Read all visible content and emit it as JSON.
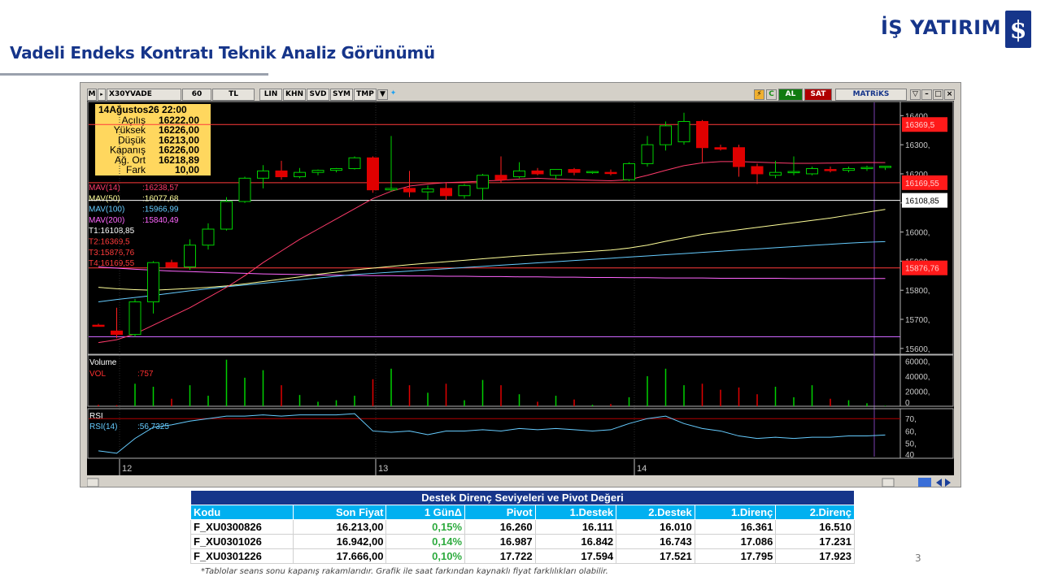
{
  "slide": {
    "title": "Vadeli Endeks Kontratı Teknik Analiz Görünümü",
    "logo_text": "İŞ YATIRIM",
    "page_number": "3",
    "footnote": "*Tablolar seans sonu kapanış rakamlarıdır. Grafik ile saat farkından kaynaklı fiyat farklılıkları olabilir."
  },
  "colors": {
    "brand": "#16358a",
    "table_header": "#00b0f0",
    "positive": "#2eab3f",
    "up_candle": "#00c000",
    "down_candle": "#e00000"
  },
  "toolbar": {
    "menu": "M",
    "symbol": "X30YVADE",
    "period": "60",
    "currency": "TL",
    "buttons": [
      "LIN",
      "KHN",
      "SVD",
      "SYM",
      "TMP"
    ],
    "al": "AL",
    "sat": "SAT",
    "brand": "MATRiKS"
  },
  "info_box": {
    "date": "14Ağustos26 22:00",
    "rows": [
      {
        "label": "Açılış",
        "value": "16222,00"
      },
      {
        "label": "Yüksek",
        "value": "16226,00"
      },
      {
        "label": "Düşük",
        "value": "16213,00"
      },
      {
        "label": "Kapanış",
        "value": "16226,00"
      },
      {
        "label": "Ağ. Ort",
        "value": "16218,89"
      },
      {
        "label": "Fark",
        "value": "10,00"
      }
    ]
  },
  "indicators": [
    {
      "label": "MAV(14)",
      "value": ":16238,57",
      "color": "#ff3b6b"
    },
    {
      "label": "MAV(50)",
      "value": ":16077,68",
      "color": "#ffff99"
    },
    {
      "label": "MAV(100)",
      "value": ":15966,99",
      "color": "#66ccff"
    },
    {
      "label": "MAV(200)",
      "value": ":15840,49",
      "color": "#ff66ff"
    },
    {
      "label": "T1:16108,85",
      "value": "",
      "color": "#ffffff"
    },
    {
      "label": "T2:16369,5",
      "value": "",
      "color": "#ff3b3b"
    },
    {
      "label": "T3:15876,76",
      "value": "",
      "color": "#ff3b3b"
    },
    {
      "label": "T4:16169,55",
      "value": "",
      "color": "#ff3b3b"
    }
  ],
  "price_axis": {
    "ticks": [
      "16400,",
      "16300,",
      "16200,",
      "16100,",
      "16000,",
      "15900,",
      "15800,",
      "15700,",
      "15600,"
    ],
    "markers": [
      {
        "label": "16369,5",
        "value": 16369.5,
        "style": "red"
      },
      {
        "label": "16169,55",
        "value": 16169.55,
        "style": "red"
      },
      {
        "label": "16108,85",
        "value": 16108.85,
        "style": "white"
      },
      {
        "label": "15876,76",
        "value": 15876.76,
        "style": "red"
      }
    ]
  },
  "volume_panel": {
    "title": "Volume",
    "label": "VOL",
    "value": ":757",
    "ticks": [
      "60000,",
      "40000,",
      "20000,",
      "0"
    ]
  },
  "rsi_panel": {
    "title": "RSI",
    "label": "RSI(14)",
    "value": ":56,7325",
    "ticks": [
      "70,",
      "60,",
      "50,",
      "40"
    ]
  },
  "x_axis": {
    "labels": [
      "12",
      "13",
      "14"
    ]
  },
  "chart_data": {
    "type": "candlestick",
    "price_range": [
      15580,
      16440
    ],
    "candles": [
      {
        "o": 15680,
        "h": 15685,
        "l": 15675,
        "c": 15678
      },
      {
        "o": 15660,
        "h": 15740,
        "l": 15635,
        "c": 15648
      },
      {
        "o": 15648,
        "h": 15770,
        "l": 15640,
        "c": 15760
      },
      {
        "o": 15760,
        "h": 15900,
        "l": 15720,
        "c": 15895
      },
      {
        "o": 15895,
        "h": 15905,
        "l": 15880,
        "c": 15880
      },
      {
        "o": 15880,
        "h": 15975,
        "l": 15870,
        "c": 15955
      },
      {
        "o": 15955,
        "h": 16030,
        "l": 15940,
        "c": 16010
      },
      {
        "o": 16010,
        "h": 16120,
        "l": 16005,
        "c": 16105
      },
      {
        "o": 16105,
        "h": 16190,
        "l": 16100,
        "c": 16185
      },
      {
        "o": 16185,
        "h": 16230,
        "l": 16150,
        "c": 16210
      },
      {
        "o": 16210,
        "h": 16245,
        "l": 16180,
        "c": 16190
      },
      {
        "o": 16190,
        "h": 16220,
        "l": 16185,
        "c": 16205
      },
      {
        "o": 16205,
        "h": 16215,
        "l": 16195,
        "c": 16212
      },
      {
        "o": 16212,
        "h": 16220,
        "l": 16205,
        "c": 16218
      },
      {
        "o": 16218,
        "h": 16260,
        "l": 16215,
        "c": 16255
      },
      {
        "o": 16255,
        "h": 16260,
        "l": 16135,
        "c": 16145
      },
      {
        "o": 16145,
        "h": 16330,
        "l": 16140,
        "c": 16150
      },
      {
        "o": 16150,
        "h": 16210,
        "l": 16120,
        "c": 16138
      },
      {
        "o": 16138,
        "h": 16160,
        "l": 16110,
        "c": 16148
      },
      {
        "o": 16150,
        "h": 16170,
        "l": 16110,
        "c": 16125
      },
      {
        "o": 16125,
        "h": 16165,
        "l": 16115,
        "c": 16160
      },
      {
        "o": 16150,
        "h": 16200,
        "l": 16110,
        "c": 16195
      },
      {
        "o": 16195,
        "h": 16260,
        "l": 16170,
        "c": 16180
      },
      {
        "o": 16190,
        "h": 16240,
        "l": 16185,
        "c": 16210
      },
      {
        "o": 16210,
        "h": 16220,
        "l": 16195,
        "c": 16200
      },
      {
        "o": 16195,
        "h": 16215,
        "l": 16180,
        "c": 16215
      },
      {
        "o": 16215,
        "h": 16220,
        "l": 16195,
        "c": 16205
      },
      {
        "o": 16205,
        "h": 16210,
        "l": 16200,
        "c": 16208
      },
      {
        "o": 16205,
        "h": 16215,
        "l": 16195,
        "c": 16202
      },
      {
        "o": 16180,
        "h": 16240,
        "l": 16175,
        "c": 16235
      },
      {
        "o": 16235,
        "h": 16330,
        "l": 16225,
        "c": 16300
      },
      {
        "o": 16300,
        "h": 16380,
        "l": 16280,
        "c": 16365
      },
      {
        "o": 16310,
        "h": 16410,
        "l": 16300,
        "c": 16380
      },
      {
        "o": 16380,
        "h": 16385,
        "l": 16240,
        "c": 16290
      },
      {
        "o": 16290,
        "h": 16300,
        "l": 16280,
        "c": 16285
      },
      {
        "o": 16290,
        "h": 16300,
        "l": 16190,
        "c": 16225
      },
      {
        "o": 16225,
        "h": 16235,
        "l": 16165,
        "c": 16200
      },
      {
        "o": 16195,
        "h": 16245,
        "l": 16185,
        "c": 16205
      },
      {
        "o": 16205,
        "h": 16260,
        "l": 16195,
        "c": 16208
      },
      {
        "o": 16200,
        "h": 16225,
        "l": 16195,
        "c": 16218
      },
      {
        "o": 16215,
        "h": 16225,
        "l": 16205,
        "c": 16212
      },
      {
        "o": 16212,
        "h": 16225,
        "l": 16205,
        "c": 16218
      },
      {
        "o": 16218,
        "h": 16228,
        "l": 16210,
        "c": 16222
      },
      {
        "o": 16222,
        "h": 16226,
        "l": 16213,
        "c": 16226
      }
    ],
    "volume": [
      2000,
      1500,
      30000,
      26000,
      10000,
      28000,
      14000,
      62000,
      38000,
      48000,
      28000,
      15000,
      6000,
      8000,
      14000,
      36000,
      50000,
      28000,
      18000,
      30000,
      8000,
      35000,
      28000,
      16000,
      6000,
      14000,
      9000,
      2000,
      3000,
      12000,
      40000,
      50000,
      28000,
      30000,
      22000,
      25000,
      16000,
      26000,
      12000,
      28000,
      10000,
      8000,
      4000,
      757
    ],
    "rsi": [
      44,
      42,
      54,
      63,
      65,
      68,
      70,
      72,
      72,
      73,
      72,
      73,
      73,
      73,
      74,
      60,
      59,
      60,
      57,
      60,
      60,
      61,
      60,
      62,
      61,
      62,
      61,
      60,
      61,
      66,
      70,
      72,
      66,
      62,
      60,
      56,
      54,
      55,
      54,
      55,
      55,
      56,
      56,
      56.73
    ],
    "rsi_range": [
      38,
      78
    ],
    "volume_range": [
      0,
      66000
    ],
    "ma14": [
      15620,
      15630,
      15650,
      15680,
      15710,
      15740,
      15775,
      15810,
      15850,
      15895,
      15935,
      15975,
      16010,
      16045,
      16080,
      16115,
      16140,
      16158,
      16165,
      16170,
      16172,
      16175,
      16178,
      16182,
      16185,
      16182,
      16180,
      16178,
      16176,
      16180,
      16195,
      16212,
      16228,
      16238,
      16242,
      16242,
      16240,
      16238,
      16236,
      16236,
      16237,
      16238,
      16239,
      16238.57
    ],
    "ma50": [
      15810,
      15805,
      15802,
      15800,
      15803,
      15806,
      15810,
      15815,
      15822,
      15830,
      15838,
      15846,
      15855,
      15862,
      15870,
      15876,
      15882,
      15888,
      15893,
      15898,
      15903,
      15908,
      15913,
      15918,
      15922,
      15926,
      15930,
      15934,
      15938,
      15945,
      15955,
      15968,
      15980,
      15992,
      16000,
      16008,
      16016,
      16024,
      16032,
      16040,
      16048,
      16058,
      16068,
      16077.68
    ],
    "ma100": [
      15760,
      15768,
      15775,
      15782,
      15790,
      15798,
      15805,
      15812,
      15818,
      15824,
      15830,
      15836,
      15842,
      15848,
      15854,
      15858,
      15862,
      15866,
      15870,
      15874,
      15878,
      15882,
      15886,
      15890,
      15894,
      15898,
      15902,
      15906,
      15910,
      15914,
      15918,
      15922,
      15926,
      15930,
      15934,
      15938,
      15942,
      15946,
      15950,
      15954,
      15958,
      15962,
      15965,
      15966.99
    ],
    "ma200": [
      15880,
      15876,
      15872,
      15869,
      15866,
      15864,
      15862,
      15860,
      15858,
      15856,
      15855,
      15854,
      15853,
      15852,
      15851,
      15850,
      15850,
      15849,
      15849,
      15848,
      15848,
      15847,
      15847,
      15846,
      15846,
      15845,
      15845,
      15844,
      15844,
      15843,
      15843,
      15842,
      15842,
      15842,
      15841,
      15841,
      15841,
      15841,
      15840,
      15840,
      15840,
      15840,
      15840,
      15840.49
    ],
    "levels": [
      {
        "name": "T2",
        "value": 16369.5,
        "color": "#ff3b3b"
      },
      {
        "name": "T4",
        "value": 16169.55,
        "color": "#ff3b3b"
      },
      {
        "name": "T1",
        "value": 16108.85,
        "color": "#ffffff"
      },
      {
        "name": "T3",
        "value": 15876.76,
        "color": "#ff3b3b"
      },
      {
        "name": "low",
        "value": 15640,
        "color": "#cc66ff"
      }
    ]
  },
  "pivot_table": {
    "title": "Destek Direnç Seviyeleri ve Pivot Değeri",
    "headers": [
      "Kodu",
      "Son Fiyat",
      "1 GünΔ",
      "Pivot",
      "1.Destek",
      "2.Destek",
      "1.Direnç",
      "2.Direnç"
    ],
    "rows": [
      [
        "F_XU0300826",
        "16.213,00",
        "0,15%",
        "16.260",
        "16.111",
        "16.010",
        "16.361",
        "16.510"
      ],
      [
        "F_XU0301026",
        "16.942,00",
        "0,14%",
        "16.987",
        "16.842",
        "16.743",
        "17.086",
        "17.231"
      ],
      [
        "F_XU0301226",
        "17.666,00",
        "0,10%",
        "17.722",
        "17.594",
        "17.521",
        "17.795",
        "17.923"
      ]
    ]
  }
}
